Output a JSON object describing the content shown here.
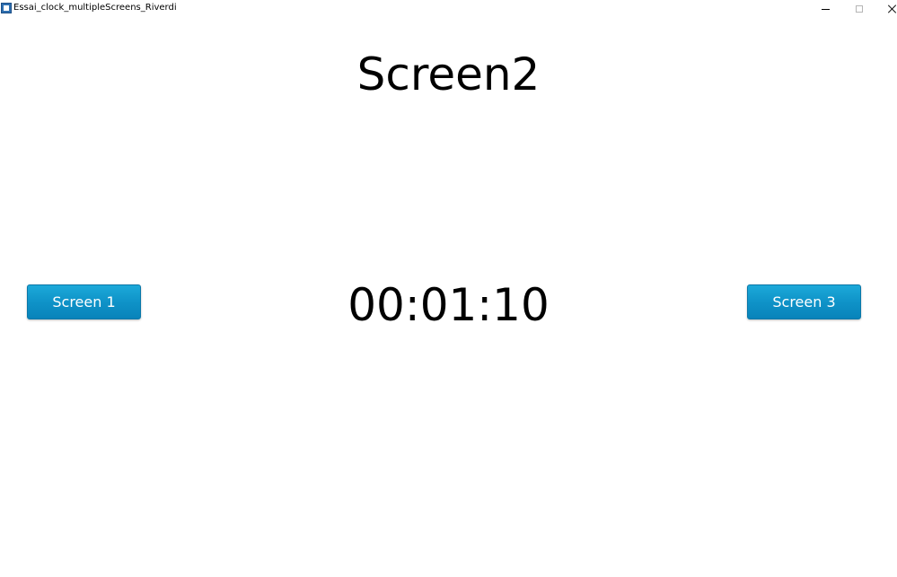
{
  "window": {
    "title": "Essai_clock_multipleScreens_Riverdi"
  },
  "screen": {
    "title": "Screen2",
    "clock": "00:01:10"
  },
  "buttons": {
    "left_label": "Screen 1",
    "right_label": "Screen 3"
  },
  "colors": {
    "button_top": "#1ca9d9",
    "button_bottom": "#0883ba",
    "background": "#ffffff"
  }
}
